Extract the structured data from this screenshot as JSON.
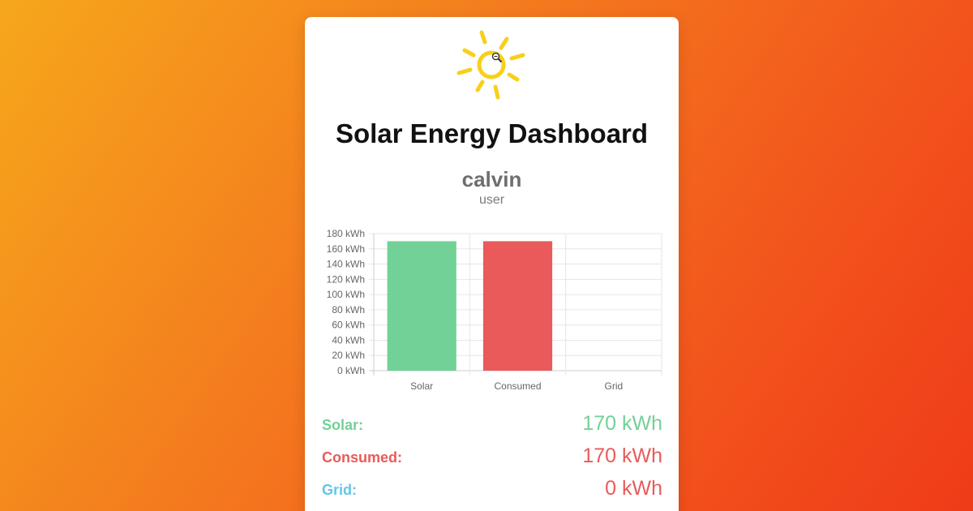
{
  "header": {
    "title": "Solar Energy Dashboard",
    "sun_icon": "sun-icon"
  },
  "user": {
    "name": "calvin",
    "role": "user"
  },
  "colors": {
    "solar": "#72d196",
    "consumed": "#ea5a5a",
    "grid": "#62c6ea"
  },
  "chart_data": {
    "type": "bar",
    "categories": [
      "Solar",
      "Consumed",
      "Grid"
    ],
    "values": [
      170,
      170,
      0
    ],
    "unit": "kWh",
    "ylim": [
      0,
      180
    ],
    "yticks": [
      "0 kWh",
      "20 kWh",
      "40 kWh",
      "60 kWh",
      "80 kWh",
      "100 kWh",
      "120 kWh",
      "140 kWh",
      "160 kWh",
      "180 kWh"
    ],
    "grid": true,
    "legend": "none"
  },
  "stats": [
    {
      "label": "Solar:",
      "value": "170 kWh",
      "label_color": "#72d196",
      "value_color": "#72d196"
    },
    {
      "label": "Consumed:",
      "value": "170 kWh",
      "label_color": "#ea5a5a",
      "value_color": "#ea5a5a"
    },
    {
      "label": "Grid:",
      "value": "0 kWh",
      "label_color": "#62c6ea",
      "value_color": "#ea5a5a"
    }
  ]
}
